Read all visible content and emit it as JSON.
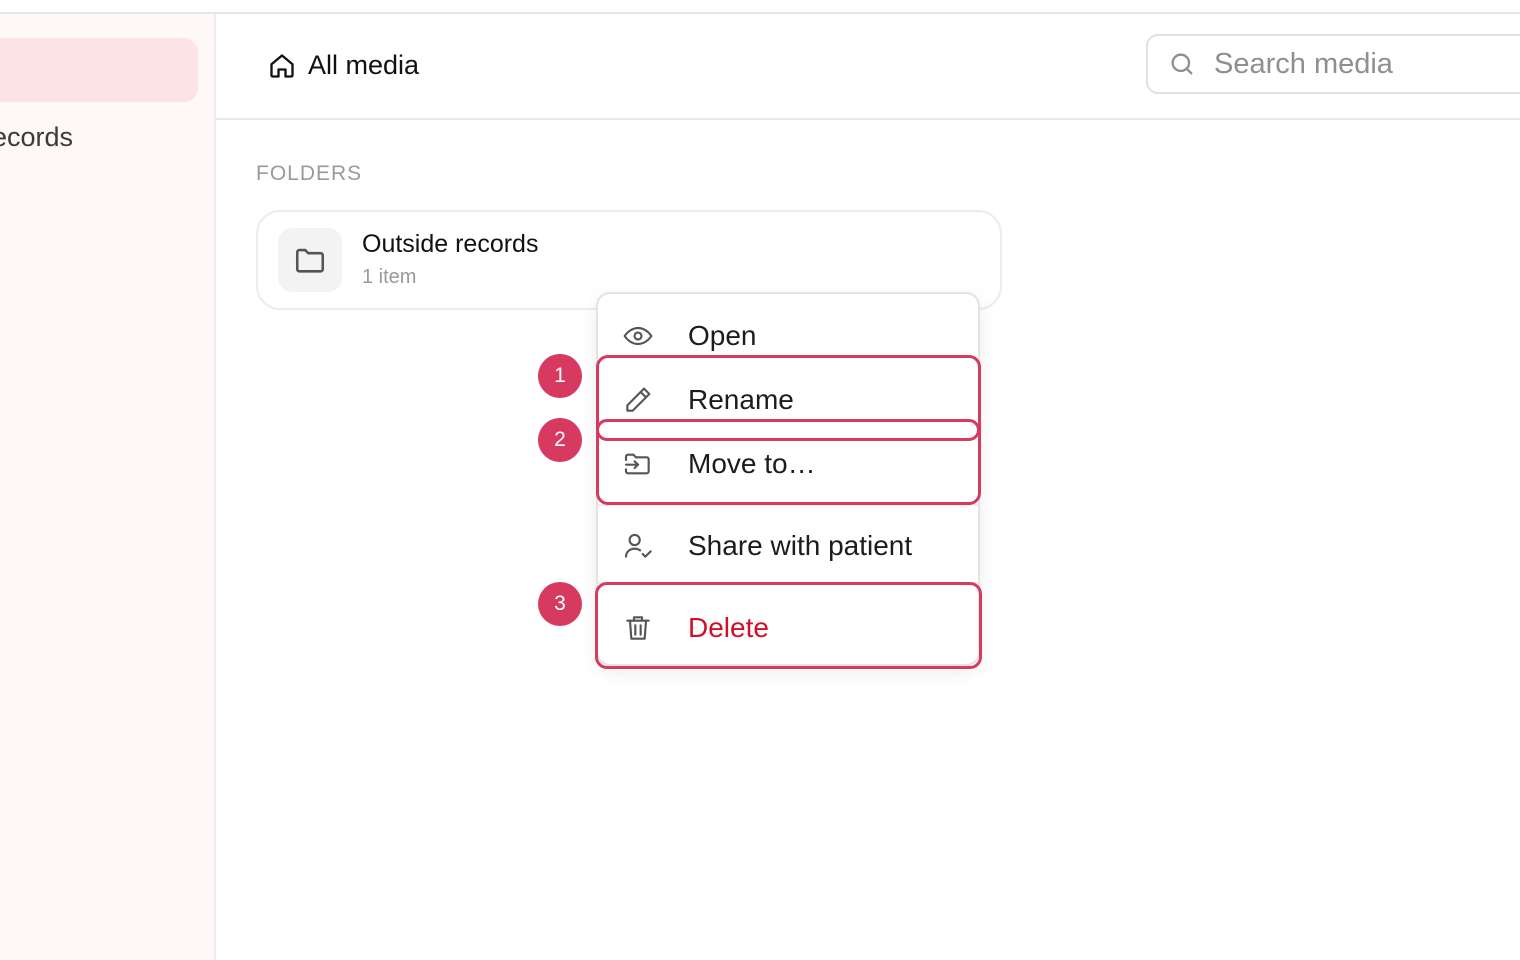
{
  "sidebar": {
    "items": [
      {
        "label": "",
        "active": true
      },
      {
        "label": "Outside records",
        "active": false
      }
    ]
  },
  "header": {
    "breadcrumb": {
      "icon": "home-icon",
      "label": "All media"
    },
    "search": {
      "placeholder": "Search media",
      "value": ""
    }
  },
  "main": {
    "section_title": "FOLDERS",
    "folders": [
      {
        "name": "Outside records",
        "count": "1 item",
        "icon": "folder-icon"
      }
    ]
  },
  "context_menu": {
    "items": [
      {
        "label": "Open",
        "icon": "eye-icon"
      },
      {
        "label": "Rename",
        "icon": "pencil-icon"
      },
      {
        "label": "Move to…",
        "icon": "folder-move-icon"
      },
      {
        "label": "Share with patient",
        "icon": "user-check-icon"
      },
      {
        "label": "Delete",
        "icon": "trash-icon",
        "danger": true
      }
    ]
  },
  "annotations": {
    "badges": [
      "1",
      "2",
      "3"
    ],
    "color": "#d63a5e"
  },
  "colors": {
    "accent": "#d63a5e",
    "danger": "#d0102a",
    "sidebar_bg": "#fef8f6",
    "sidebar_active": "#fde3e6"
  }
}
